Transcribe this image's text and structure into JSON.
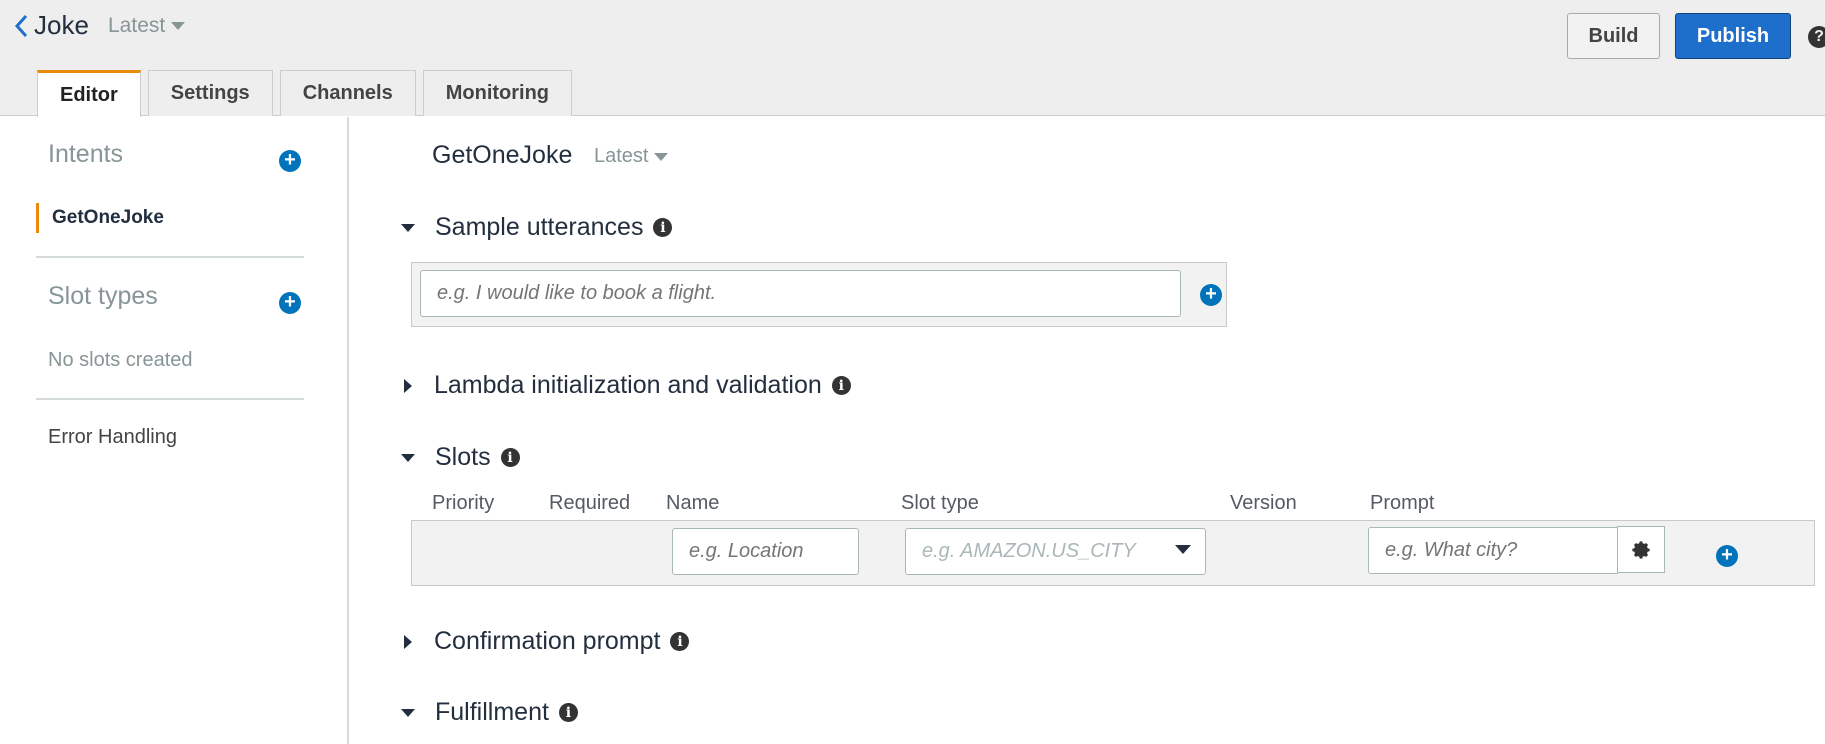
{
  "header": {
    "bot_name": "Joke",
    "version": "Latest",
    "build_label": "Build",
    "publish_label": "Publish",
    "help_glyph": "?"
  },
  "tabs": [
    {
      "label": "Editor",
      "active": true
    },
    {
      "label": "Settings",
      "active": false
    },
    {
      "label": "Channels",
      "active": false
    },
    {
      "label": "Monitoring",
      "active": false
    }
  ],
  "sidebar": {
    "intents_title": "Intents",
    "intents": [
      "GetOneJoke"
    ],
    "slot_types_title": "Slot types",
    "no_slots_text": "No slots created",
    "error_handling_label": "Error Handling"
  },
  "intent": {
    "name": "GetOneJoke",
    "version": "Latest"
  },
  "sections": {
    "sample_utterances": "Sample utterances",
    "lambda": "Lambda initialization and validation",
    "slots": "Slots",
    "confirmation": "Confirmation prompt",
    "fulfillment": "Fulfillment"
  },
  "utterance": {
    "placeholder": "e.g. I would like to book a flight.",
    "value": ""
  },
  "slots_table": {
    "columns": [
      "Priority",
      "Required",
      "Name",
      "Slot type",
      "Version",
      "Prompt"
    ],
    "name_placeholder": "e.g. Location",
    "slot_type_placeholder": "e.g. AMAZON.US_CITY",
    "prompt_placeholder": "e.g. What city?"
  },
  "icons": {
    "back": "chevron-left-icon",
    "add": "plus-circle-icon",
    "info": "info-icon",
    "gear": "gear-icon"
  },
  "colors": {
    "accent_orange": "#e88b0c",
    "primary_blue": "#1d6fcb",
    "add_blue": "#0073bb"
  }
}
